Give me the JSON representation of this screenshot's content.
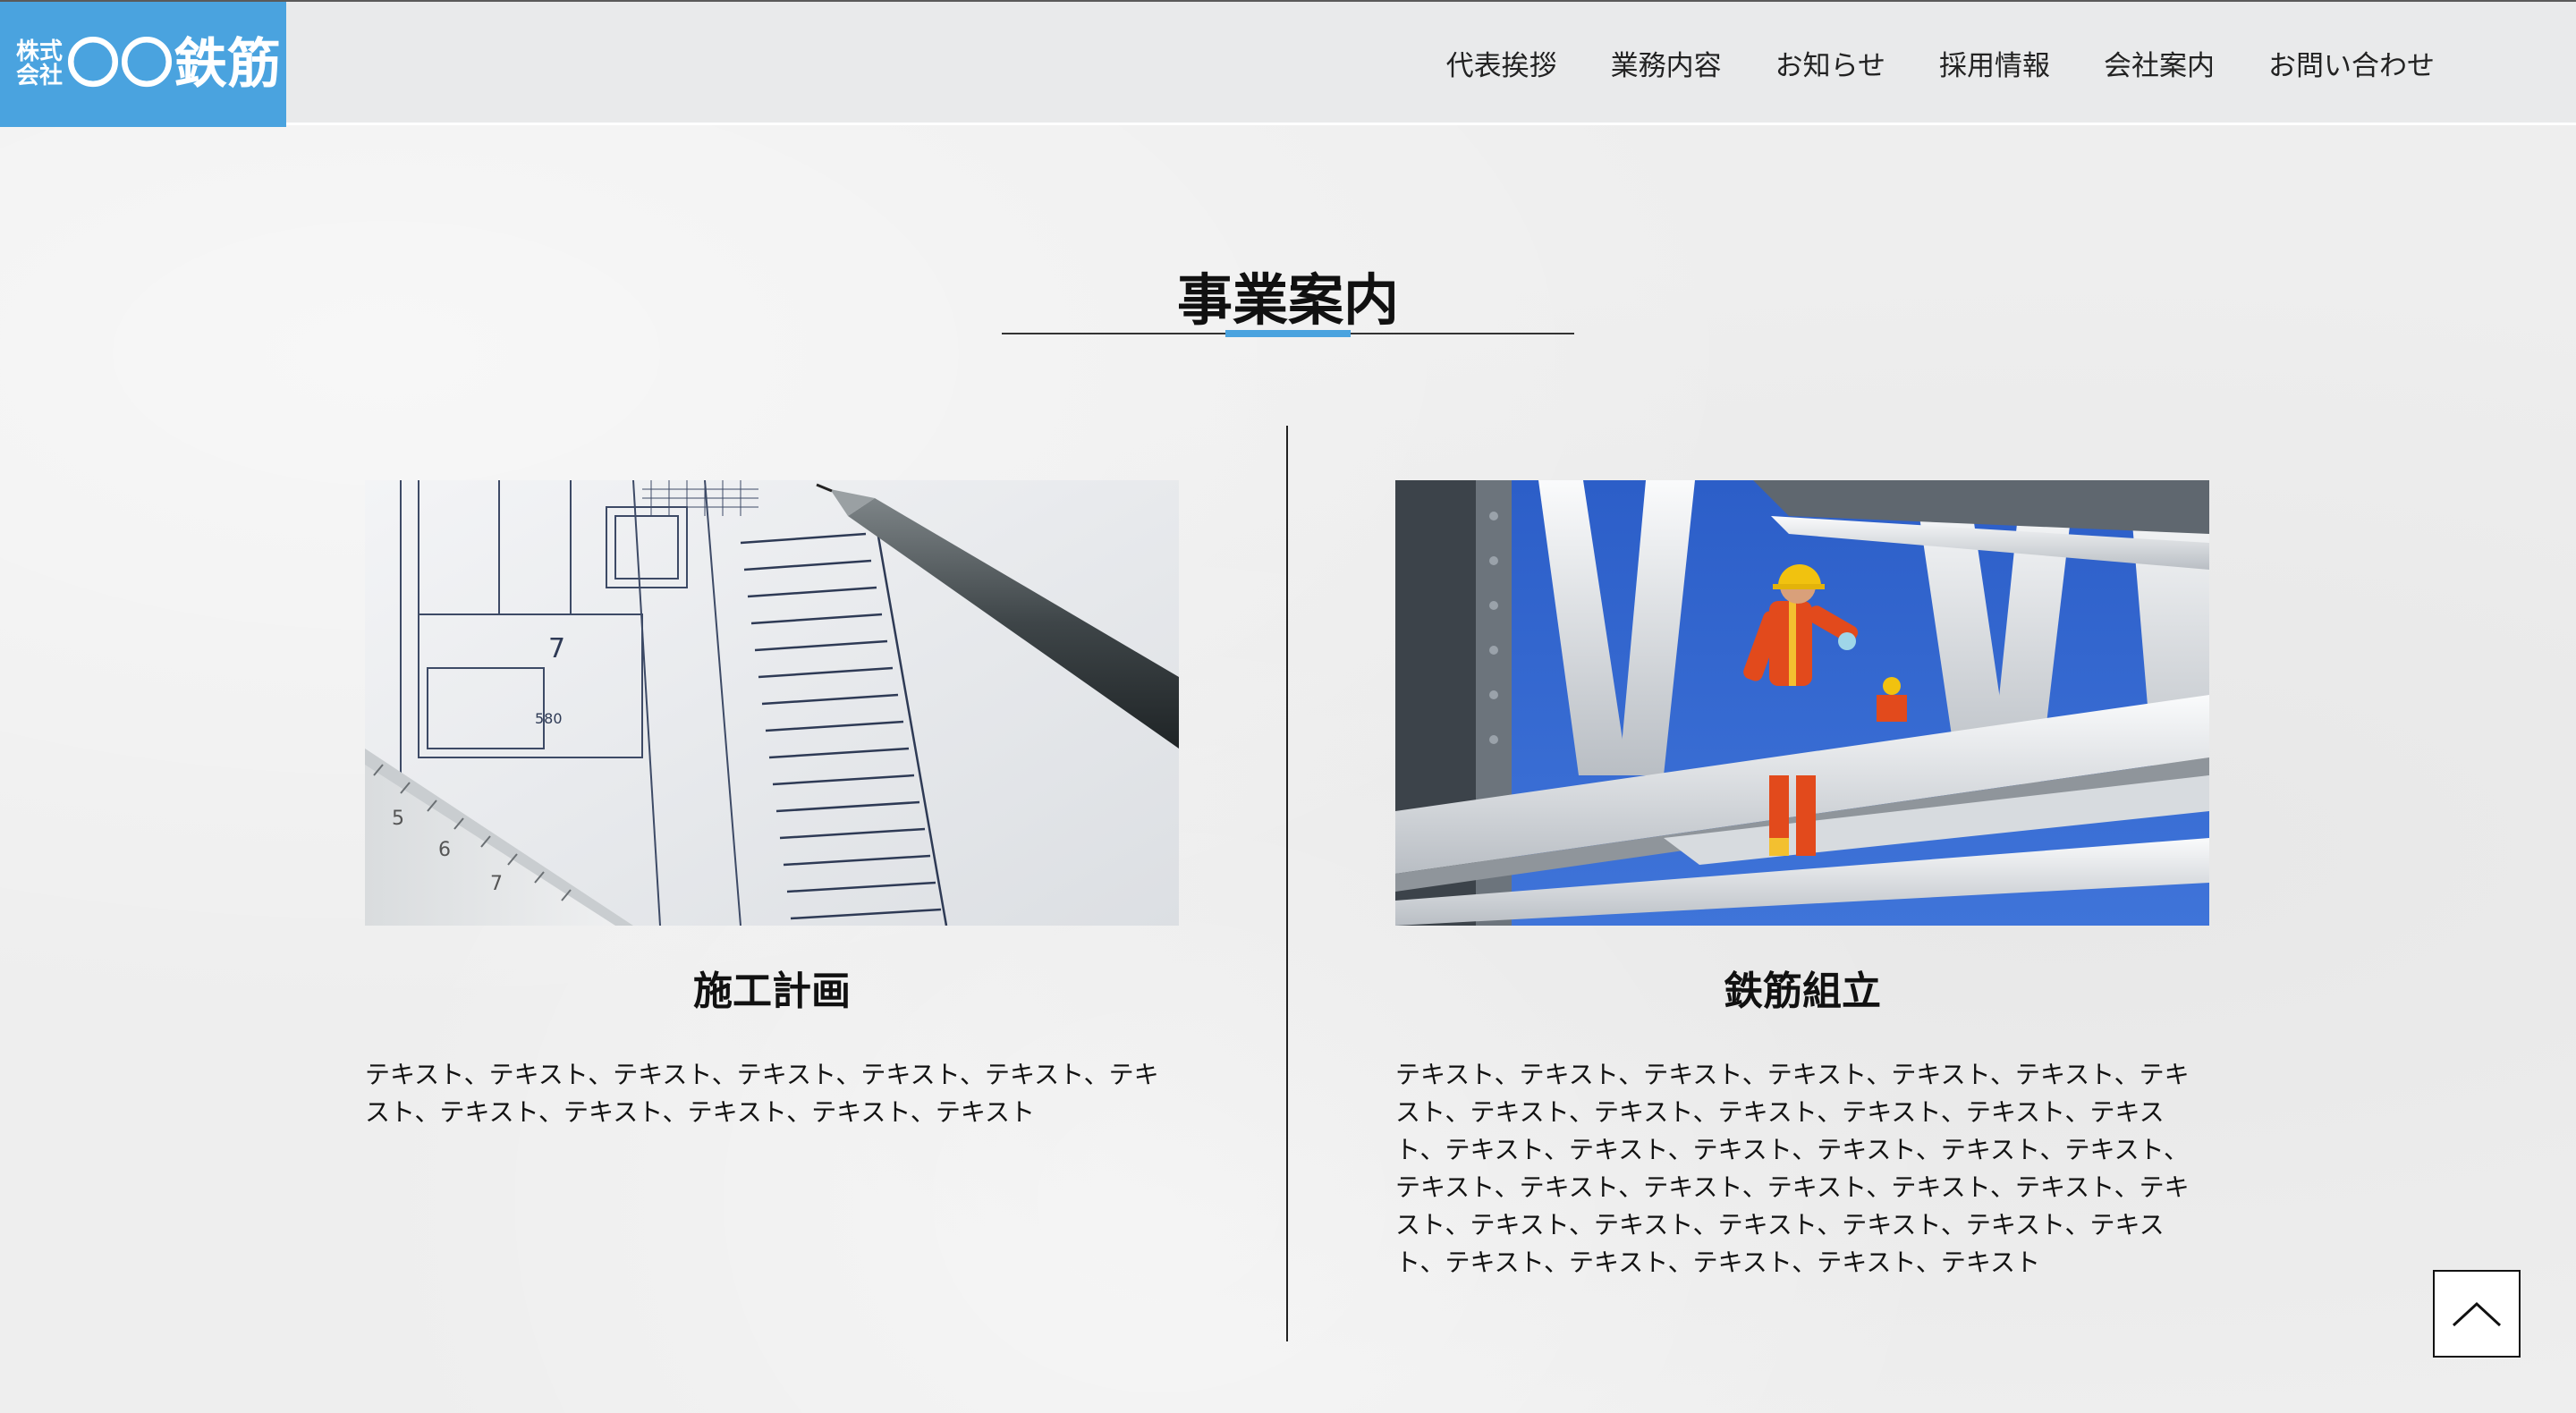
{
  "brand": {
    "logo_small_line1": "株式",
    "logo_small_line2": "会社",
    "logo_big": "〇〇鉄筋"
  },
  "nav": {
    "items": [
      {
        "label": "代表挨拶"
      },
      {
        "label": "業務内容"
      },
      {
        "label": "お知らせ"
      },
      {
        "label": "採用情報"
      },
      {
        "label": "会社案内"
      },
      {
        "label": "お問い合わせ"
      }
    ]
  },
  "section": {
    "title": "事業案内"
  },
  "cards": [
    {
      "title": "施工計画",
      "image_alt": "blueprint-with-pen",
      "text": "テキスト、テキスト、テキスト、テキスト、テキスト、テキスト、テキスト、テキスト、テキスト、テキスト、テキスト、テキスト"
    },
    {
      "title": "鉄筋組立",
      "image_alt": "steel-frame-worker",
      "text": "テキスト、テキスト、テキスト、テキスト、テキスト、テキスト、テキスト、テキスト、テキスト、テキスト、テキスト、テキスト、テキスト、テキスト、テキスト、テキスト、テキスト、テキスト、テキスト、テキスト、テキスト、テキスト、テキスト、テキスト、テキスト、テキスト、テキスト、テキスト、テキスト、テキスト、テキスト、テキスト、テキスト、テキスト、テキスト、テキスト、テキスト"
    }
  ],
  "colors": {
    "accent": "#4aa3df",
    "background": "#eeeeee",
    "text": "#111111"
  },
  "back_to_top": {
    "icon": "chevron-up-icon"
  }
}
